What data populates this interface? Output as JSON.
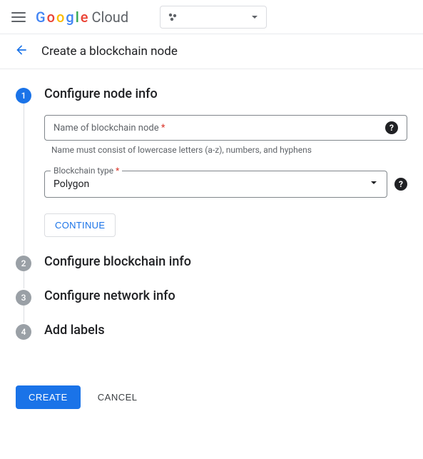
{
  "header": {
    "logo_text": "Cloud"
  },
  "page": {
    "title": "Create a blockchain node"
  },
  "steps": {
    "s1": {
      "num": "1",
      "title": "Configure node info"
    },
    "s2": {
      "num": "2",
      "title": "Configure blockchain info"
    },
    "s3": {
      "num": "3",
      "title": "Configure network info"
    },
    "s4": {
      "num": "4",
      "title": "Add labels"
    }
  },
  "form": {
    "name_placeholder": "Name of blockchain node",
    "name_helper": "Name must consist of lowercase letters (a-z), numbers, and hyphens",
    "blockchain_type_label": "Blockchain type",
    "blockchain_type_value": "Polygon",
    "required_marker": "*",
    "continue_label": "CONTINUE"
  },
  "actions": {
    "create": "CREATE",
    "cancel": "CANCEL"
  }
}
